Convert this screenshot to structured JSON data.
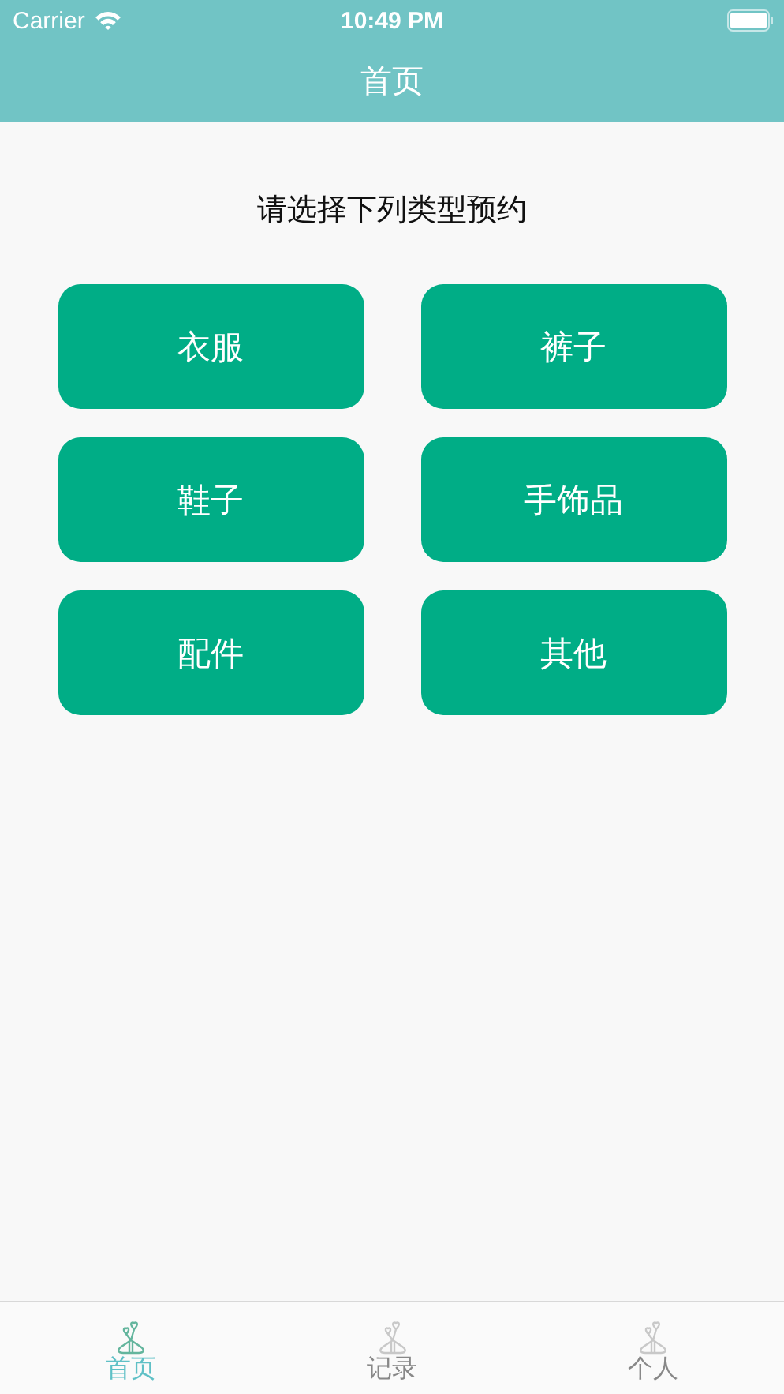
{
  "status_bar": {
    "carrier": "Carrier",
    "time": "10:49 PM"
  },
  "nav_bar": {
    "title": "首页"
  },
  "prompt": "请选择下列类型预约",
  "categories": [
    "衣服",
    "裤子",
    "鞋子",
    "手饰品",
    "配件",
    "其他"
  ],
  "tab_bar": [
    {
      "label": "首页",
      "selected": true
    },
    {
      "label": "记录",
      "selected": false
    },
    {
      "label": "个人",
      "selected": false
    }
  ]
}
